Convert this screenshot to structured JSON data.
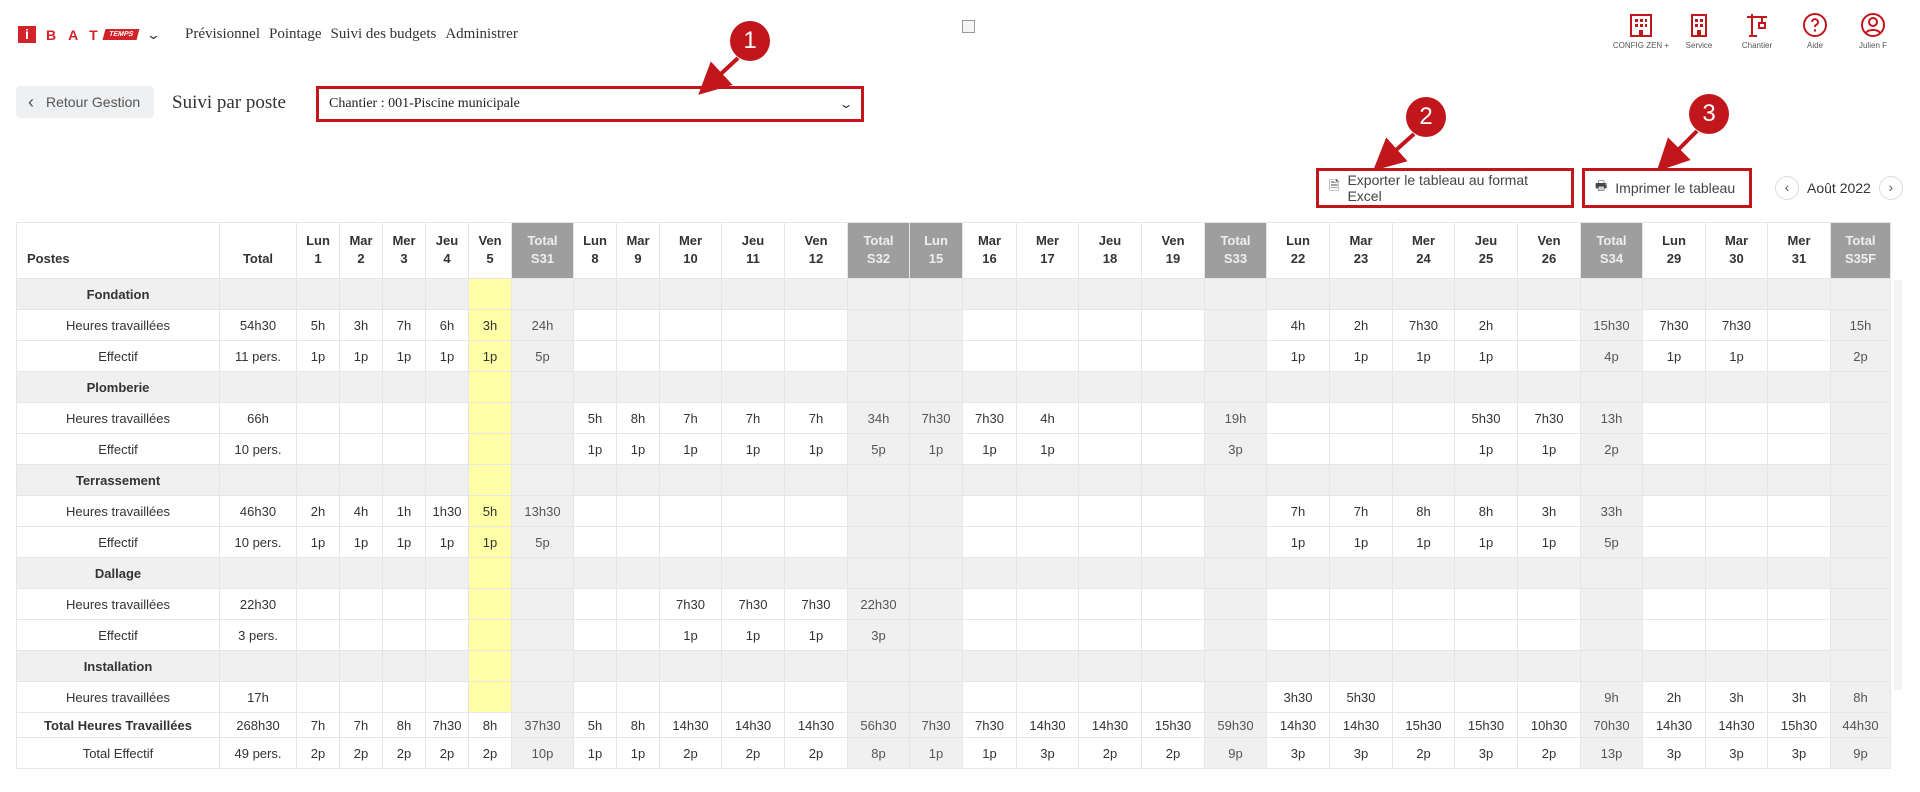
{
  "header": {
    "logo_letter": "i",
    "logo_text": "BAT",
    "logo_tag": "TEMPS",
    "nav": [
      "Prévisionnel",
      "Pointage",
      "Suivi des budgets",
      "Administrer"
    ],
    "icons": [
      {
        "name": "building-icon",
        "label": "CONFIG ZEN +"
      },
      {
        "name": "service-building-icon",
        "label": "Service"
      },
      {
        "name": "crane-icon",
        "label": "Chantier"
      },
      {
        "name": "help-icon",
        "label": "Aide"
      },
      {
        "name": "user-icon",
        "label": "Julien F"
      }
    ]
  },
  "subbar": {
    "back_label": "Retour Gestion",
    "title": "Suivi par poste",
    "select_value": "Chantier : 001-Piscine municipale"
  },
  "toolbar": {
    "export_label": "Exporter le tableau au format Excel",
    "print_label": "Imprimer le tableau",
    "month_label": "Août 2022"
  },
  "callouts": [
    "1",
    "2",
    "3"
  ],
  "accent_color": "#c0161c",
  "table": {
    "headers": [
      {
        "l1": "",
        "l2": "Postes"
      },
      {
        "l1": "",
        "l2": "Total"
      },
      {
        "l1": "Lun",
        "l2": "1"
      },
      {
        "l1": "Mar",
        "l2": "2"
      },
      {
        "l1": "Mer",
        "l2": "3"
      },
      {
        "l1": "Jeu",
        "l2": "4"
      },
      {
        "l1": "Ven",
        "l2": "5"
      },
      {
        "l1": "Total",
        "l2": "S31",
        "tot": true
      },
      {
        "l1": "Lun",
        "l2": "8"
      },
      {
        "l1": "Mar",
        "l2": "9"
      },
      {
        "l1": "Mer",
        "l2": "10"
      },
      {
        "l1": "Jeu",
        "l2": "11"
      },
      {
        "l1": "Ven",
        "l2": "12"
      },
      {
        "l1": "Total",
        "l2": "S32",
        "tot": true
      },
      {
        "l1": "Lun",
        "l2": "15",
        "tot": true
      },
      {
        "l1": "Mar",
        "l2": "16"
      },
      {
        "l1": "Mer",
        "l2": "17"
      },
      {
        "l1": "Jeu",
        "l2": "18"
      },
      {
        "l1": "Ven",
        "l2": "19"
      },
      {
        "l1": "Total",
        "l2": "S33",
        "tot": true
      },
      {
        "l1": "Lun",
        "l2": "22"
      },
      {
        "l1": "Mar",
        "l2": "23"
      },
      {
        "l1": "Mer",
        "l2": "24"
      },
      {
        "l1": "Jeu",
        "l2": "25"
      },
      {
        "l1": "Ven",
        "l2": "26"
      },
      {
        "l1": "Total",
        "l2": "S34",
        "tot": true
      },
      {
        "l1": "Lun",
        "l2": "29"
      },
      {
        "l1": "Mar",
        "l2": "30"
      },
      {
        "l1": "Mer",
        "l2": "31"
      },
      {
        "l1": "Total",
        "l2": "S35F",
        "tot": true
      }
    ],
    "rows": [
      {
        "type": "sec",
        "cells": [
          "Fondation"
        ]
      },
      {
        "type": "row",
        "cells": [
          "Heures travaillées",
          "54h30",
          "5h",
          "3h",
          "7h",
          "6h",
          "3h",
          "24h",
          "",
          "",
          "",
          "",
          "",
          "",
          "",
          "",
          "",
          "",
          "",
          "",
          "4h",
          "2h",
          "7h30",
          "2h",
          "",
          "15h30",
          "7h30",
          "7h30",
          "",
          "15h"
        ]
      },
      {
        "type": "row",
        "cells": [
          "Effectif",
          "11 pers.",
          "1p",
          "1p",
          "1p",
          "1p",
          "1p",
          "5p",
          "",
          "",
          "",
          "",
          "",
          "",
          "",
          "",
          "",
          "",
          "",
          "",
          "1p",
          "1p",
          "1p",
          "1p",
          "",
          "4p",
          "1p",
          "1p",
          "",
          "2p"
        ]
      },
      {
        "type": "sec",
        "cells": [
          "Plomberie"
        ]
      },
      {
        "type": "row",
        "cells": [
          "Heures travaillées",
          "66h",
          "",
          "",
          "",
          "",
          "",
          "",
          "5h",
          "8h",
          "7h",
          "7h",
          "7h",
          "34h",
          "7h30",
          "7h30",
          "4h",
          "",
          "",
          "19h",
          "",
          "",
          "",
          "5h30",
          "7h30",
          "13h",
          "",
          "",
          "",
          ""
        ]
      },
      {
        "type": "row",
        "cells": [
          "Effectif",
          "10 pers.",
          "",
          "",
          "",
          "",
          "",
          "",
          "1p",
          "1p",
          "1p",
          "1p",
          "1p",
          "5p",
          "1p",
          "1p",
          "1p",
          "",
          "",
          "3p",
          "",
          "",
          "",
          "1p",
          "1p",
          "2p",
          "",
          "",
          "",
          ""
        ]
      },
      {
        "type": "sec",
        "cells": [
          "Terrassement"
        ]
      },
      {
        "type": "row",
        "cells": [
          "Heures travaillées",
          "46h30",
          "2h",
          "4h",
          "1h",
          "1h30",
          "5h",
          "13h30",
          "",
          "",
          "",
          "",
          "",
          "",
          "",
          "",
          "",
          "",
          "",
          "",
          "7h",
          "7h",
          "8h",
          "8h",
          "3h",
          "33h",
          "",
          "",
          "",
          ""
        ]
      },
      {
        "type": "row",
        "cells": [
          "Effectif",
          "10 pers.",
          "1p",
          "1p",
          "1p",
          "1p",
          "1p",
          "5p",
          "",
          "",
          "",
          "",
          "",
          "",
          "",
          "",
          "",
          "",
          "",
          "",
          "1p",
          "1p",
          "1p",
          "1p",
          "1p",
          "5p",
          "",
          "",
          "",
          ""
        ]
      },
      {
        "type": "sec",
        "cells": [
          "Dallage"
        ]
      },
      {
        "type": "row",
        "cells": [
          "Heures travaillées",
          "22h30",
          "",
          "",
          "",
          "",
          "",
          "",
          "",
          "",
          "7h30",
          "7h30",
          "7h30",
          "22h30",
          "",
          "",
          "",
          "",
          "",
          "",
          "",
          "",
          "",
          "",
          "",
          "",
          "",
          "",
          "",
          ""
        ]
      },
      {
        "type": "row",
        "cells": [
          "Effectif",
          "3 pers.",
          "",
          "",
          "",
          "",
          "",
          "",
          "",
          "",
          "1p",
          "1p",
          "1p",
          "3p",
          "",
          "",
          "",
          "",
          "",
          "",
          "",
          "",
          "",
          "",
          "",
          "",
          "",
          "",
          "",
          ""
        ]
      },
      {
        "type": "sec",
        "cells": [
          "Installation"
        ]
      },
      {
        "type": "row",
        "cells": [
          "Heures travaillées",
          "17h",
          "",
          "",
          "",
          "",
          "",
          "",
          "",
          "",
          "",
          "",
          "",
          "",
          "",
          "",
          "",
          "",
          "",
          "",
          "3h30",
          "5h30",
          "",
          "",
          "",
          "9h",
          "2h",
          "3h",
          "3h",
          "8h"
        ]
      },
      {
        "type": "sum",
        "cells": [
          "Total Heures Travaillées",
          "268h30",
          "7h",
          "7h",
          "8h",
          "7h30",
          "8h",
          "37h30",
          "5h",
          "8h",
          "14h30",
          "14h30",
          "14h30",
          "56h30",
          "7h30",
          "7h30",
          "14h30",
          "14h30",
          "15h30",
          "59h30",
          "14h30",
          "14h30",
          "15h30",
          "15h30",
          "10h30",
          "70h30",
          "14h30",
          "14h30",
          "15h30",
          "44h30"
        ]
      },
      {
        "type": "sum2",
        "cells": [
          "Total Effectif",
          "49 pers.",
          "2p",
          "2p",
          "2p",
          "2p",
          "2p",
          "10p",
          "1p",
          "1p",
          "2p",
          "2p",
          "2p",
          "8p",
          "1p",
          "1p",
          "3p",
          "2p",
          "2p",
          "9p",
          "3p",
          "3p",
          "2p",
          "3p",
          "2p",
          "13p",
          "3p",
          "3p",
          "3p",
          "9p"
        ]
      }
    ]
  }
}
